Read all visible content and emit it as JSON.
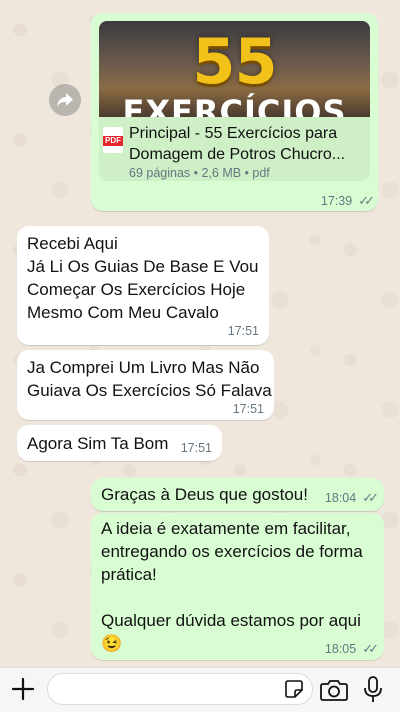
{
  "document_message": {
    "thumbnail_number": "55",
    "thumbnail_word": "EXERCÍCIOS",
    "icon_label": "PDF",
    "title": "Principal - 55 Exercícios para Domagem de Potros Chucro...",
    "meta": "69 páginas • 2,6 MB • pdf",
    "time": "17:39"
  },
  "messages": [
    {
      "text": "Recebi Aqui\nJá Li Os Guias De Base E Vou\nComeçar Os Exercícios Hoje\nMesmo Com Meu Cavalo",
      "time": "17:51"
    },
    {
      "text": "Ja Comprei Um Livro Mas Não\nGuiava Os Exercícios Só Falava",
      "time": "17:51"
    },
    {
      "text": "Agora Sim Ta Bom",
      "time": "17:51"
    },
    {
      "text": "Graças à Deus que gostou!",
      "time": "18:04"
    },
    {
      "text": "A ideia é exatamente em facilitar,\nentregando os exercícios de forma\nprática!\n\nQualquer dúvida estamos por aqui\n😉",
      "time": "18:05"
    }
  ],
  "input": {
    "placeholder": ""
  }
}
